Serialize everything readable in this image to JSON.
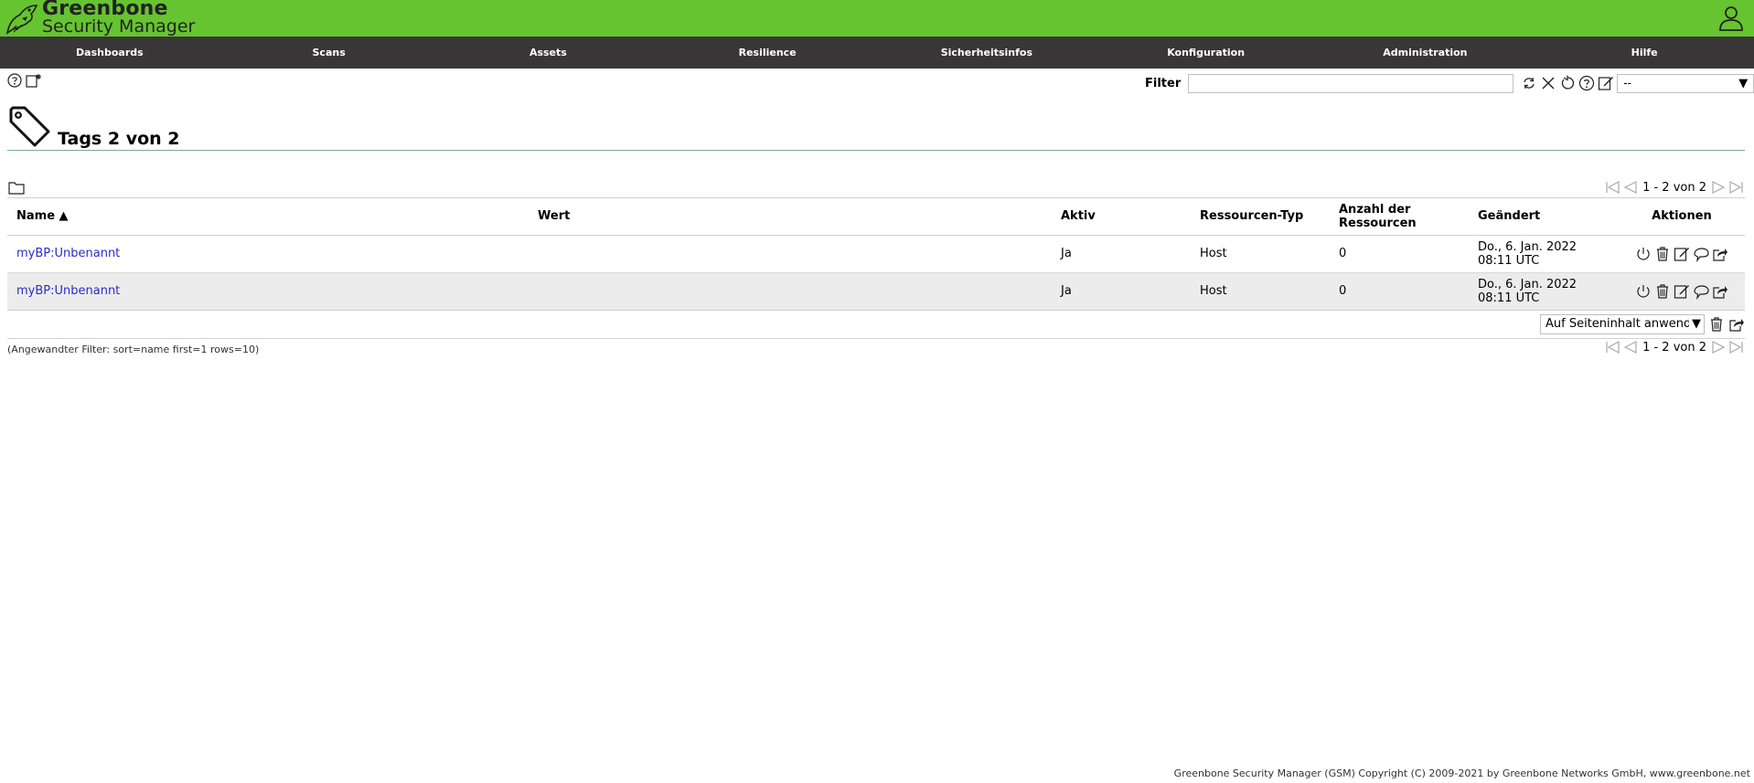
{
  "header": {
    "brand_name": "Greenbone",
    "brand_sub": "Security Manager",
    "colors": {
      "topbar": "#66c430",
      "menubar": "#393637"
    }
  },
  "menu": [
    {
      "label": "Dashboards"
    },
    {
      "label": "Scans"
    },
    {
      "label": "Assets"
    },
    {
      "label": "Resilience"
    },
    {
      "label": "Sicherheitsinfos"
    },
    {
      "label": "Konfiguration"
    },
    {
      "label": "Administration"
    },
    {
      "label": "Hilfe"
    }
  ],
  "toolbar": {
    "icons": [
      "help-icon",
      "new-tag-icon"
    ]
  },
  "filter": {
    "label": "Filter",
    "value": "",
    "icons": [
      "refresh-icon",
      "clear-icon",
      "reset-icon",
      "help-icon",
      "edit-icon"
    ],
    "select_value": "--"
  },
  "page": {
    "title": "Tags 2 von 2",
    "icon": "tag-icon"
  },
  "pagination": {
    "text": "1 - 2 von 2"
  },
  "table": {
    "headers": {
      "name": "Name ▲",
      "wert": "Wert",
      "aktiv": "Aktiv",
      "typ": "Ressourcen-Typ",
      "anzahl_line1": "Anzahl der",
      "anzahl_line2": "Ressourcen",
      "geaendert": "Geändert",
      "aktionen": "Aktionen"
    },
    "rows": [
      {
        "name": "myBP:Unbenannt",
        "wert": "",
        "aktiv": "Ja",
        "typ": "Host",
        "anzahl": "0",
        "geaendert_date": "Do., 6. Jan. 2022",
        "geaendert_time": "08:11 UTC",
        "actions": [
          "disable-icon",
          "trashcan-icon",
          "edit-icon",
          "clone-icon",
          "export-icon"
        ]
      },
      {
        "name": "myBP:Unbenannt",
        "wert": "",
        "aktiv": "Ja",
        "typ": "Host",
        "anzahl": "0",
        "geaendert_date": "Do., 6. Jan. 2022",
        "geaendert_time": "08:11 UTC",
        "actions": [
          "disable-icon",
          "trashcan-icon",
          "edit-icon",
          "clone-icon",
          "export-icon"
        ]
      }
    ]
  },
  "bulk": {
    "select_value": "Auf Seiteninhalt anwenden",
    "icons": [
      "trashcan-icon",
      "export-icon"
    ]
  },
  "applied_filter": "(Angewandter Filter: sort=name first=1 rows=10)",
  "footer": "Greenbone Security Manager (GSM) Copyright (C) 2009-2021 by Greenbone Networks GmbH, www.greenbone.net"
}
